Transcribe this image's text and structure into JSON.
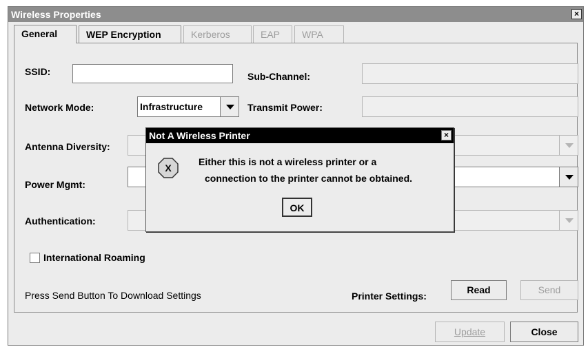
{
  "window": {
    "title": "Wireless Properties",
    "close_glyph": "×"
  },
  "tabs": [
    {
      "label": "General",
      "active": true,
      "enabled": true
    },
    {
      "label": "WEP Encryption",
      "active": false,
      "enabled": true
    },
    {
      "label": "Kerberos",
      "active": false,
      "enabled": false
    },
    {
      "label": "EAP",
      "active": false,
      "enabled": false
    },
    {
      "label": "WPA",
      "active": false,
      "enabled": false
    }
  ],
  "form": {
    "ssid_label": "SSID:",
    "ssid_value": "",
    "sub_channel_label": "Sub-Channel:",
    "network_mode_label": "Network Mode:",
    "network_mode_value": "Infrastructure",
    "transmit_power_label": "Transmit Power:",
    "antenna_diversity_label": "Antenna Diversity:",
    "power_mgmt_label": "Power Mgmt:",
    "authentication_label": "Authentication:",
    "international_roaming_label": "International Roaming",
    "international_roaming_checked": false
  },
  "footer": {
    "hint": "Press Send Button To Download Settings",
    "printer_settings_label": "Printer Settings:",
    "read_label": "Read",
    "send_label": "Send",
    "update_label": "Update",
    "close_label": "Close"
  },
  "dialog": {
    "title": "Not A Wireless Printer",
    "close_glyph": "×",
    "line1": "Either this is not a wireless printer or a",
    "line2": "connection to the printer cannot be obtained.",
    "ok_label": "OK",
    "icon_glyph": "X"
  },
  "icons": [
    "close-icon",
    "dropdown-arrow-icon",
    "error-icon"
  ]
}
